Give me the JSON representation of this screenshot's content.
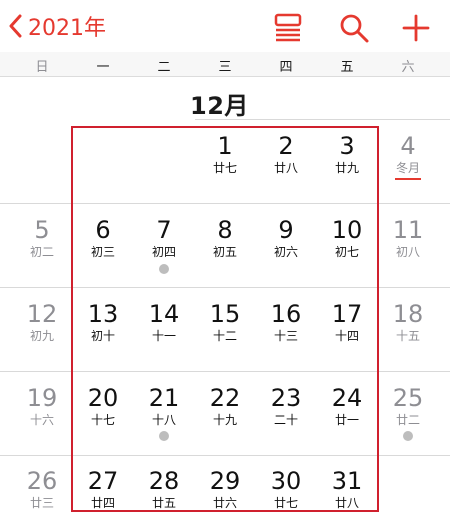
{
  "toolbar": {
    "back_label": "2021年",
    "accent": "#e5392f",
    "icons": [
      "list-view-icon",
      "search-icon",
      "add-icon"
    ]
  },
  "weekdays": [
    "日",
    "一",
    "二",
    "三",
    "四",
    "五",
    "六"
  ],
  "month": {
    "title": "12月"
  },
  "weeks": [
    [
      null,
      null,
      null,
      {
        "day": "1",
        "lunar": "廿七"
      },
      {
        "day": "2",
        "lunar": "廿八"
      },
      {
        "day": "3",
        "lunar": "廿九"
      },
      {
        "day": "4",
        "lunar": "冬月",
        "marked": true
      }
    ],
    [
      {
        "day": "5",
        "lunar": "初二"
      },
      {
        "day": "6",
        "lunar": "初三"
      },
      {
        "day": "7",
        "lunar": "初四",
        "event": true
      },
      {
        "day": "8",
        "lunar": "初五"
      },
      {
        "day": "9",
        "lunar": "初六"
      },
      {
        "day": "10",
        "lunar": "初七"
      },
      {
        "day": "11",
        "lunar": "初八"
      }
    ],
    [
      {
        "day": "12",
        "lunar": "初九"
      },
      {
        "day": "13",
        "lunar": "初十"
      },
      {
        "day": "14",
        "lunar": "十一"
      },
      {
        "day": "15",
        "lunar": "十二"
      },
      {
        "day": "16",
        "lunar": "十三"
      },
      {
        "day": "17",
        "lunar": "十四"
      },
      {
        "day": "18",
        "lunar": "十五"
      }
    ],
    [
      {
        "day": "19",
        "lunar": "十六"
      },
      {
        "day": "20",
        "lunar": "十七"
      },
      {
        "day": "21",
        "lunar": "十八",
        "event": true
      },
      {
        "day": "22",
        "lunar": "十九"
      },
      {
        "day": "23",
        "lunar": "二十"
      },
      {
        "day": "24",
        "lunar": "廿一"
      },
      {
        "day": "25",
        "lunar": "廿二",
        "event": true
      }
    ],
    [
      {
        "day": "26",
        "lunar": "廿三"
      },
      {
        "day": "27",
        "lunar": "廿四"
      },
      {
        "day": "28",
        "lunar": "廿五"
      },
      {
        "day": "29",
        "lunar": "廿六"
      },
      {
        "day": "30",
        "lunar": "廿七"
      },
      {
        "day": "31",
        "lunar": "廿八"
      },
      null
    ]
  ]
}
